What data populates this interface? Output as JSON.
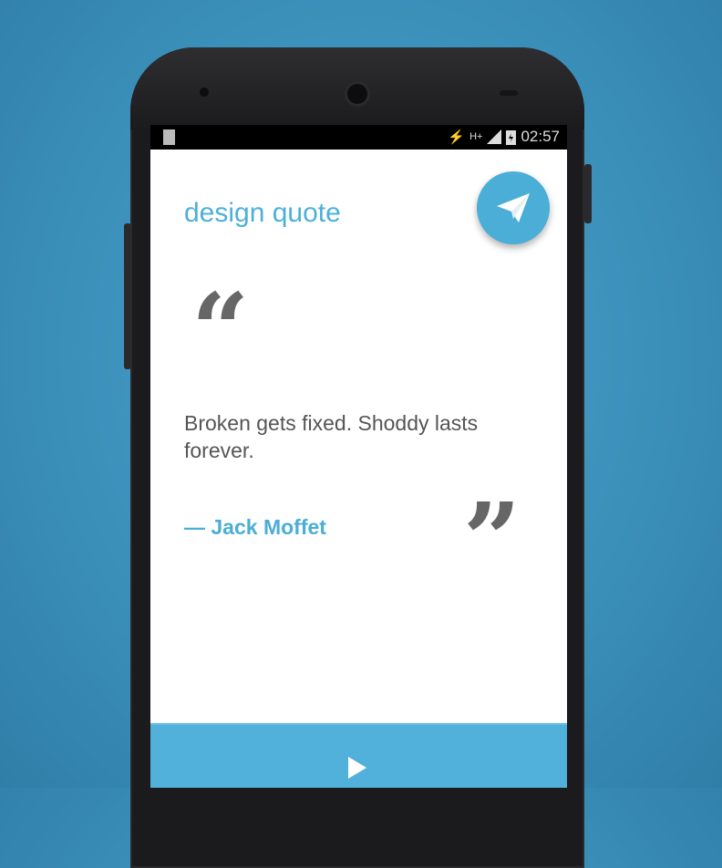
{
  "status_bar": {
    "network": "H+",
    "time": "02:57"
  },
  "app": {
    "title": "design quote",
    "send_icon": "paper-plane-icon"
  },
  "quote": {
    "open_mark": "“",
    "text": "Broken gets fixed. Shoddy lasts forever.",
    "author": "— Jack Moffet",
    "close_mark": "”"
  },
  "bottom_bar": {
    "play_icon": "play-icon"
  },
  "colors": {
    "accent": "#4aaed6",
    "background": "#3a8fb9",
    "text": "#555555"
  }
}
